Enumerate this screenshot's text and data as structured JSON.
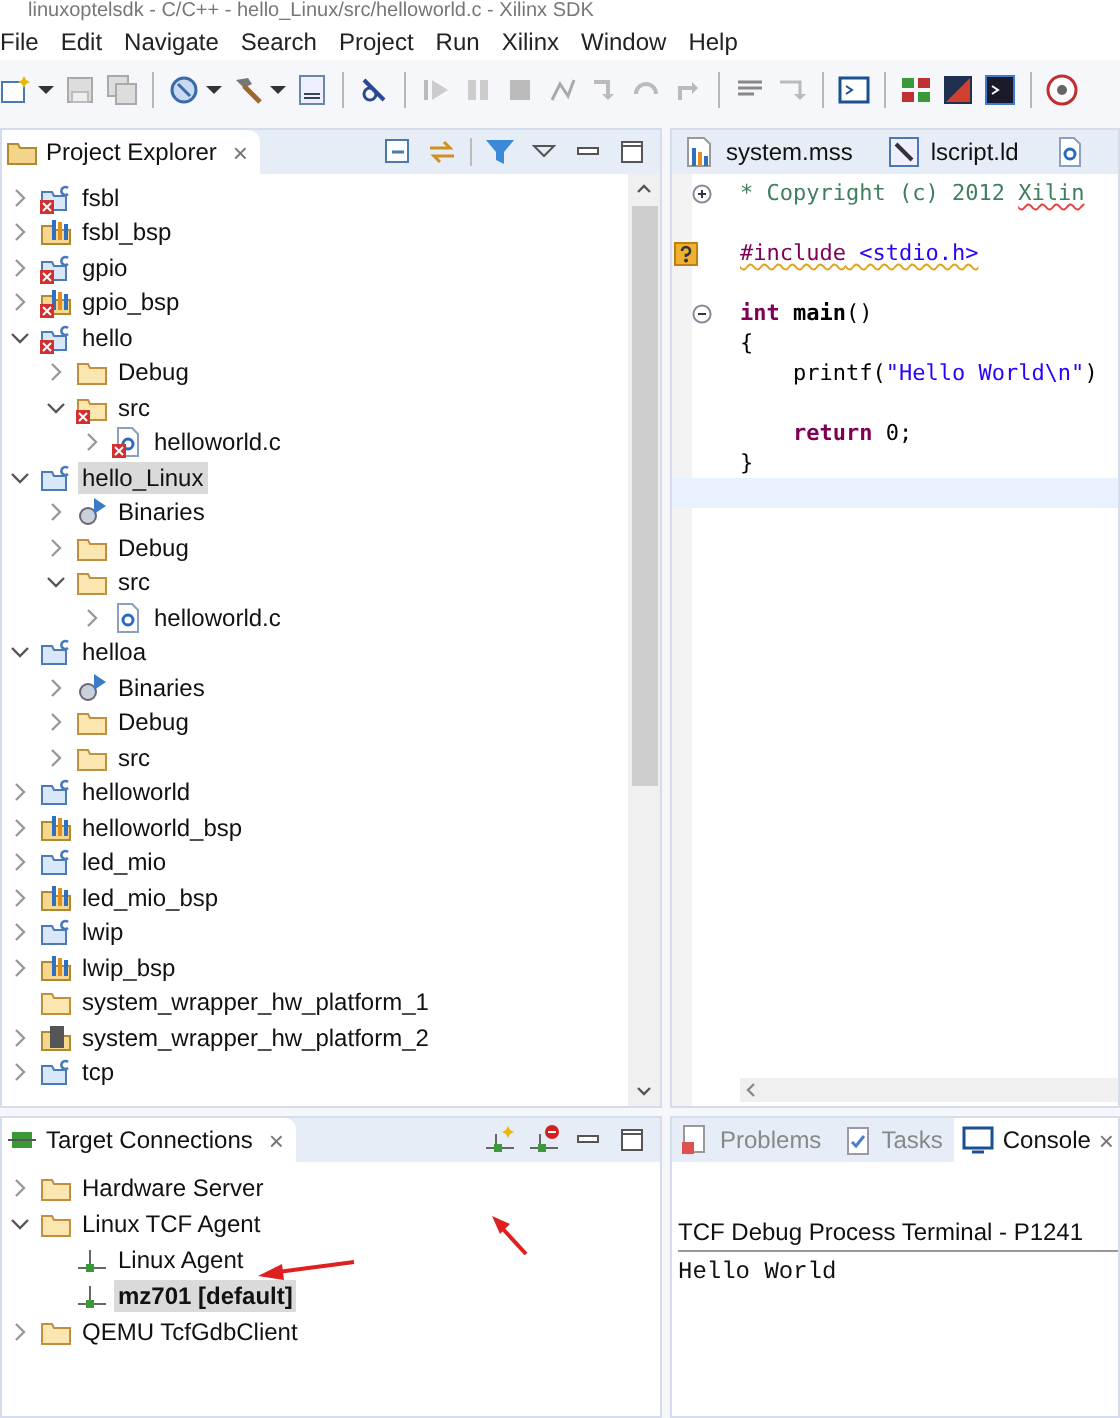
{
  "window": {
    "title": "linuxoptelsdk - C/C++ - hello_Linux/src/helloworld.c - Xilinx SDK"
  },
  "menu": [
    "File",
    "Edit",
    "Navigate",
    "Search",
    "Project",
    "Run",
    "Xilinx",
    "Window",
    "Help"
  ],
  "project_explorer": {
    "title": "Project Explorer",
    "close": "×",
    "tree": [
      {
        "label": "fsbl",
        "kind": "c-project",
        "error": true,
        "expanded": false,
        "selected": false
      },
      {
        "label": "fsbl_bsp",
        "kind": "bsp",
        "error": false,
        "expanded": false,
        "selected": false
      },
      {
        "label": "gpio",
        "kind": "c-project",
        "error": true,
        "expanded": false,
        "selected": false
      },
      {
        "label": "gpio_bsp",
        "kind": "bsp",
        "error": true,
        "expanded": false,
        "selected": false
      },
      {
        "label": "hello",
        "kind": "c-project",
        "error": true,
        "expanded": true,
        "selected": false,
        "children": [
          {
            "label": "Debug",
            "kind": "folder",
            "error": false,
            "expanded": false,
            "selected": false
          },
          {
            "label": "src",
            "kind": "folder",
            "error": true,
            "expanded": true,
            "selected": false,
            "children": [
              {
                "label": "helloworld.c",
                "kind": "c-file",
                "error": true,
                "expanded": false,
                "selected": false
              }
            ]
          }
        ]
      },
      {
        "label": "hello_Linux",
        "kind": "c-project",
        "error": false,
        "expanded": true,
        "selected": true,
        "children": [
          {
            "label": "Binaries",
            "kind": "binaries",
            "error": false,
            "expanded": false,
            "selected": false
          },
          {
            "label": "Debug",
            "kind": "folder",
            "error": false,
            "expanded": false,
            "selected": false
          },
          {
            "label": "src",
            "kind": "folder",
            "error": false,
            "expanded": true,
            "selected": false,
            "children": [
              {
                "label": "helloworld.c",
                "kind": "c-file",
                "error": false,
                "expanded": false,
                "selected": false
              }
            ]
          }
        ]
      },
      {
        "label": "helloa",
        "kind": "c-project",
        "error": false,
        "expanded": true,
        "selected": false,
        "children": [
          {
            "label": "Binaries",
            "kind": "binaries",
            "error": false,
            "expanded": false,
            "selected": false
          },
          {
            "label": "Debug",
            "kind": "folder",
            "error": false,
            "expanded": false,
            "selected": false
          },
          {
            "label": "src",
            "kind": "folder",
            "error": false,
            "expanded": false,
            "selected": false
          }
        ]
      },
      {
        "label": "helloworld",
        "kind": "c-project",
        "error": false,
        "expanded": false,
        "selected": false
      },
      {
        "label": "helloworld_bsp",
        "kind": "bsp",
        "error": false,
        "expanded": false,
        "selected": false
      },
      {
        "label": "led_mio",
        "kind": "c-project",
        "error": false,
        "expanded": false,
        "selected": false
      },
      {
        "label": "led_mio_bsp",
        "kind": "bsp",
        "error": false,
        "expanded": false,
        "selected": false
      },
      {
        "label": "lwip",
        "kind": "c-project",
        "error": false,
        "expanded": false,
        "selected": false
      },
      {
        "label": "lwip_bsp",
        "kind": "bsp",
        "error": false,
        "expanded": false,
        "selected": false
      },
      {
        "label": "system_wrapper_hw_platform_1",
        "kind": "folder",
        "error": false,
        "selected": false
      },
      {
        "label": "system_wrapper_hw_platform_2",
        "kind": "chip-platform",
        "error": false,
        "expanded": false,
        "selected": false
      },
      {
        "label": "tcp",
        "kind": "c-project",
        "error": false,
        "expanded": false,
        "selected": false
      }
    ]
  },
  "editor": {
    "tabs": [
      {
        "label": "system.mss",
        "kind": "bsp"
      },
      {
        "label": "lscript.ld",
        "kind": "linker"
      },
      {
        "kind": "c-file"
      }
    ],
    "lines": [
      {
        "folded": true,
        "tokens": [
          {
            "kind": "comment",
            "text": "* Copyright (c) 2012 "
          },
          {
            "kind": "comment",
            "text": "Xilin",
            "misspelled": true
          }
        ]
      },
      {
        "gap_before": true,
        "problem": true,
        "tokens": [
          {
            "kind": "directive",
            "text": "#include",
            "warning": true
          },
          {
            "kind": "header",
            "text": " <stdio.h>",
            "warning": true
          }
        ]
      },
      {
        "gap_before": true,
        "folded": false,
        "tokens": [
          {
            "kind": "keyword",
            "text": "int"
          },
          {
            "kind": "function",
            "text": " main"
          },
          {
            "kind": "plain",
            "text": "()"
          }
        ]
      },
      {
        "tokens": [
          {
            "kind": "plain",
            "text": "{"
          }
        ]
      },
      {
        "indent": true,
        "tokens": [
          {
            "kind": "plain",
            "text": "printf("
          },
          {
            "kind": "string",
            "text": "\"Hello World\\n\""
          },
          {
            "kind": "plain",
            "text": ")"
          }
        ]
      },
      {
        "gap_before": true,
        "indent": true,
        "tokens": [
          {
            "kind": "keyword",
            "text": "return"
          },
          {
            "kind": "plain",
            "text": " 0;"
          }
        ]
      },
      {
        "tokens": [
          {
            "kind": "plain",
            "text": "}"
          }
        ]
      },
      {
        "current": true
      }
    ]
  },
  "target_connections": {
    "title": "Target Connections",
    "close": "×",
    "tree": [
      {
        "label": "Hardware Server",
        "kind": "folder",
        "is_default": false,
        "expanded": false,
        "selected": false
      },
      {
        "label": "Linux TCF Agent",
        "kind": "folder",
        "is_default": false,
        "expanded": true,
        "selected": false,
        "children": [
          {
            "label": "Linux Agent",
            "kind": "connection",
            "is_default": false,
            "selected": false
          },
          {
            "label": "mz701 [default]",
            "kind": "connection",
            "is_default": true,
            "selected": true
          }
        ]
      },
      {
        "label": "QEMU TcfGdbClient",
        "kind": "folder",
        "is_default": false,
        "expanded": false,
        "selected": false
      }
    ]
  },
  "console": {
    "tabs": [
      {
        "label": "Problems",
        "kind": "problems",
        "selected": false
      },
      {
        "label": "Tasks",
        "kind": "tasks",
        "selected": false
      },
      {
        "label": "Console",
        "kind": "console",
        "selected": true,
        "close": "×"
      }
    ],
    "process": "TCF Debug Process Terminal - P1241",
    "output": [
      "Hello World"
    ]
  }
}
